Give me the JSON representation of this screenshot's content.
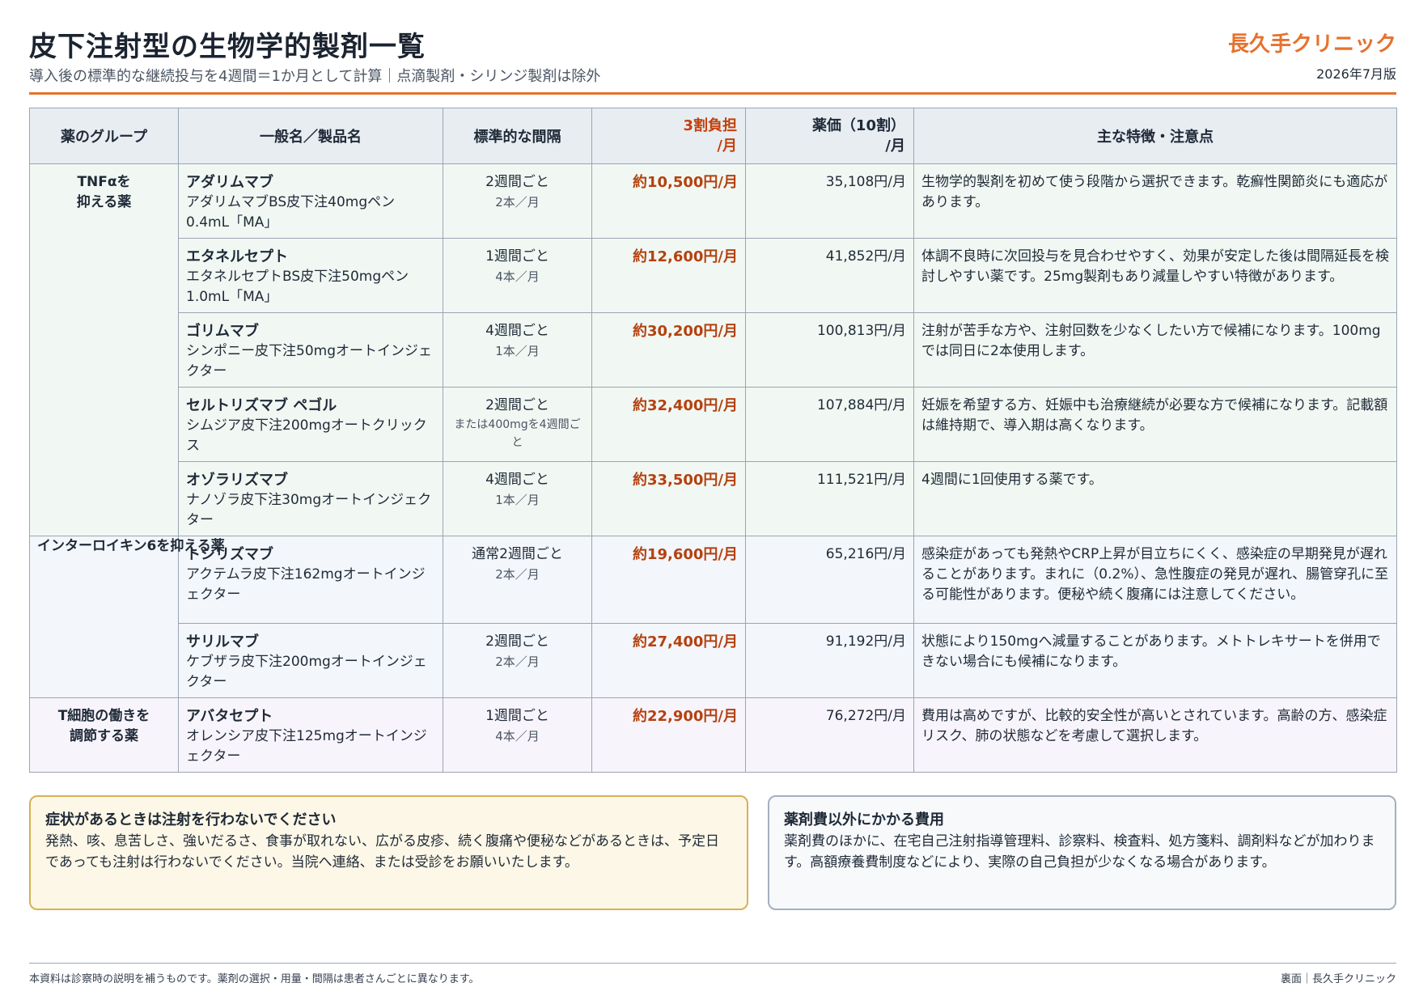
{
  "header": {
    "title": "皮下注射型の生物学的製剤一覧",
    "subtitle": "導入後の標準的な継続投与を4週間＝1か月として計算｜点滴製剤・シリンジ製剤は除外",
    "clinic": "長久手クリニック",
    "edition": "2026年7月版"
  },
  "table": {
    "headers": {
      "group": "薬のグループ",
      "name": "一般名／製品名",
      "interval": "標準的な間隔",
      "burden_l1": "3割負担",
      "burden_l2": "/月",
      "price_l1": "薬価（10割）",
      "price_l2": "/月",
      "notes": "主な特徴・注意点"
    },
    "groups": {
      "tnf": "TNFαを\n抑える薬",
      "il6": "インターロイキン6を抑える薬",
      "tcell": "T細胞の働きを\n調節する薬"
    },
    "rows": [
      {
        "name": "アダリムマブ",
        "product": "アダリムマブBS皮下注40mgペン0.4mL「MA」",
        "interval": "2週間ごと",
        "count": "2本／月",
        "burden": "約10,500円/月",
        "price": "35,108円/月",
        "note": "生物学的製剤を初めて使う段階から選択できます。乾癬性関節炎にも適応があります。"
      },
      {
        "name": "エタネルセプト",
        "product": "エタネルセプトBS皮下注50mgペン1.0mL「MA」",
        "interval": "1週間ごと",
        "count": "4本／月",
        "burden": "約12,600円/月",
        "price": "41,852円/月",
        "note": "体調不良時に次回投与を見合わせやすく、効果が安定した後は間隔延長を検討しやすい薬です。25mg製剤もあり減量しやすい特徴があります。"
      },
      {
        "name": "ゴリムマブ",
        "product": "シンポニー皮下注50mgオートインジェクター",
        "interval": "4週間ごと",
        "count": "1本／月",
        "burden": "約30,200円/月",
        "price": "100,813円/月",
        "note": "注射が苦手な方や、注射回数を少なくしたい方で候補になります。100mgでは同日に2本使用します。"
      },
      {
        "name": "セルトリズマブ ペゴル",
        "product": "シムジア皮下注200mgオートクリックス",
        "interval": "2週間ごと",
        "count": "または400mgを4週間ごと",
        "burden": "約32,400円/月",
        "price": "107,884円/月",
        "note": "妊娠を希望する方、妊娠中も治療継続が必要な方で候補になります。記載額は維持期で、導入期は高くなります。"
      },
      {
        "name": "オゾラリズマブ",
        "product": "ナノゾラ皮下注30mgオートインジェクター",
        "interval": "4週間ごと",
        "count": "1本／月",
        "burden": "約33,500円/月",
        "price": "111,521円/月",
        "note": "4週間に1回使用する薬です。"
      },
      {
        "name": "トシリズマブ",
        "product": "アクテムラ皮下注162mgオートインジェクター",
        "interval": "通常2週間ごと",
        "count": "2本／月",
        "burden": "約19,600円/月",
        "price": "65,216円/月",
        "note": "感染症があっても発熱やCRP上昇が目立ちにくく、感染症の早期発見が遅れることがあります。まれに（0.2%）、急性腹症の発見が遅れ、腸管穿孔に至る可能性があります。便秘や続く腹痛には注意してください。"
      },
      {
        "name": "サリルマブ",
        "product": "ケブザラ皮下注200mgオートインジェクター",
        "interval": "2週間ごと",
        "count": "2本／月",
        "burden": "約27,400円/月",
        "price": "91,192円/月",
        "note": "状態により150mgへ減量することがあります。メトトレキサートを併用できない場合にも候補になります。"
      },
      {
        "name": "アバタセプト",
        "product": "オレンシア皮下注125mgオートインジェクター",
        "interval": "1週間ごと",
        "count": "4本／月",
        "burden": "約22,900円/月",
        "price": "76,272円/月",
        "note": "費用は高めですが、比較的安全性が高いとされています。高齢の方、感染症リスク、肺の状態などを考慮して選択します。"
      }
    ]
  },
  "warning_box": {
    "title": "症状があるときは注射を行わないでください",
    "body": "発熱、咳、息苦しさ、強いだるさ、食事が取れない、広がる皮疹、続く腹痛や便秘などがあるときは、予定日であっても注射は行わないでください。当院へ連絡、または受診をお願いいたします。"
  },
  "cost_box": {
    "title": "薬剤費以外にかかる費用",
    "body": "薬剤費のほかに、在宅自己注射指導管理料、診察料、検査料、処方箋料、調剤料などが加わります。高額療養費制度などにより、実際の自己負担が少なくなる場合があります。"
  },
  "footer": {
    "left": "本資料は診察時の説明を補うものです。薬剤の選択・用量・間隔は患者さんごとに異なります。",
    "right": "裏面｜長久手クリニック"
  }
}
